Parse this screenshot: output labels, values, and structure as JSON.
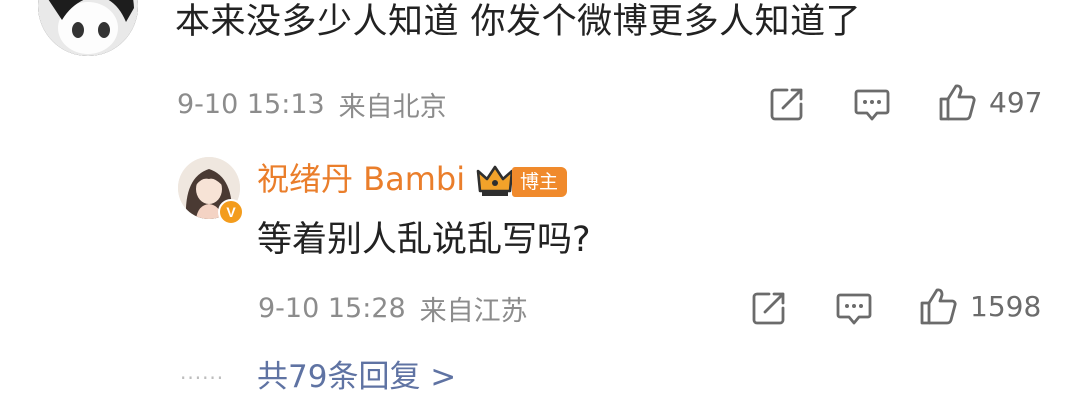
{
  "comment": {
    "text": "本来没多少人知道 你发个微博更多人知道了",
    "date": "9-10 15:13",
    "location": "来自北京",
    "likes": "497",
    "icons": [
      "share-icon",
      "comment-icon",
      "like-icon"
    ]
  },
  "reply": {
    "author": "祝绪丹 Bambi",
    "badge": "博主",
    "verified_mark": "V",
    "text": "等着别人乱说乱写吗?",
    "date": "9-10 15:28",
    "location": "来自江苏",
    "likes": "1598",
    "icons": [
      "share-icon",
      "comment-icon",
      "like-icon"
    ]
  },
  "footer": {
    "dots": "......",
    "more_replies": "共79条回复 >"
  },
  "colors": {
    "author": "#ea7e2b",
    "badge_bg": "#f08a2c",
    "meta": "#8c8c8c",
    "link": "#5f73a3"
  }
}
